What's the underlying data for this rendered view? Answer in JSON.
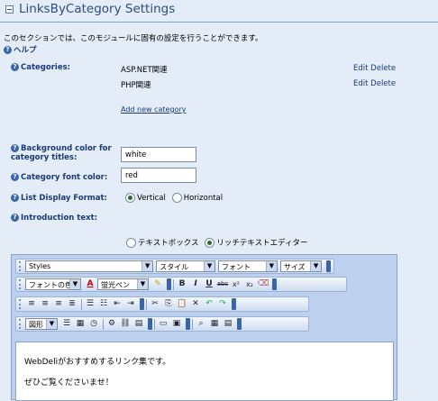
{
  "header": {
    "title": "LinksByCategory  Settings"
  },
  "description": "このセクションでは、このモジュールに固有の設定を行うことができます。",
  "help": {
    "label": "ヘルプ"
  },
  "categories": {
    "label": "Categories:",
    "items": [
      {
        "name": "ASP.NET関連",
        "edit": "Edit",
        "delete": "Delete"
      },
      {
        "name": "PHP関連",
        "edit": "Edit",
        "delete": "Delete"
      }
    ],
    "add_link": "Add new category"
  },
  "bgcolor": {
    "label": "Background color for category titles:",
    "value": "white"
  },
  "fontcolor": {
    "label": "Category font color:",
    "value": "red"
  },
  "display_format": {
    "label": "List Display Format:",
    "options": [
      "Vertical",
      "Horizontal"
    ],
    "selected": "Vertical"
  },
  "intro": {
    "label": "Introduction text:",
    "modes": [
      "テキストボックス",
      "リッチテキストエディター"
    ],
    "selected": "リッチテキストエディター"
  },
  "toolbar": {
    "styles": "Styles",
    "style_ja": "スタイル",
    "font": "フォント",
    "size": "サイズ",
    "font_color": "フォントの色",
    "highlight": "蛍光ペン",
    "shapes": "図形"
  },
  "editor_content": [
    "WebDeliがおすすめするリンク集です。",
    "ぜひご覧くださいませ！"
  ]
}
